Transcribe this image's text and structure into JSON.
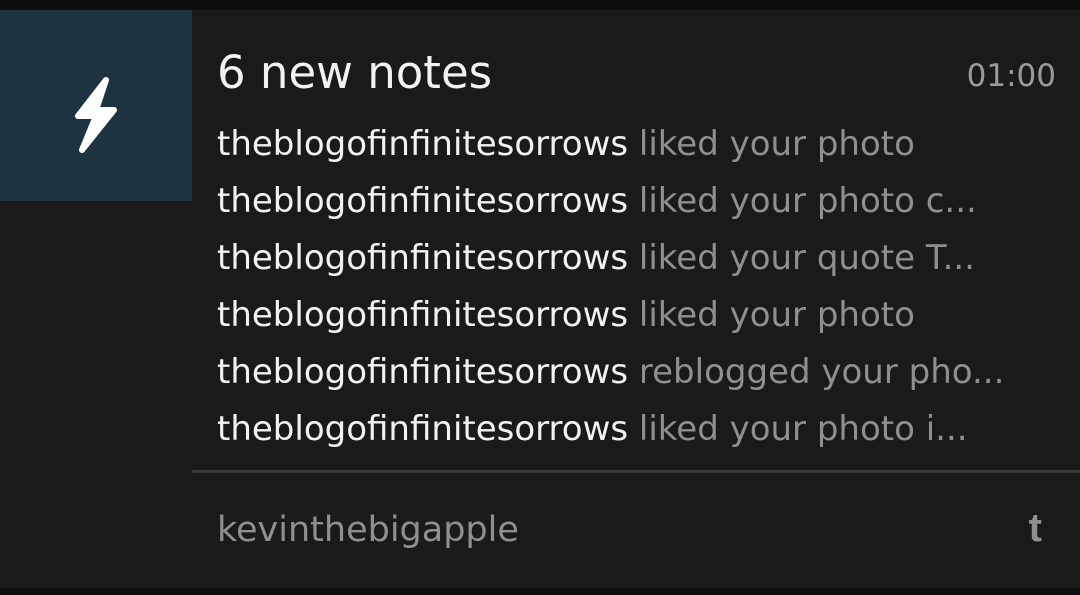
{
  "notification": {
    "title": "6 new notes",
    "time": "01:00",
    "icon": "lightning-bolt-icon",
    "accent_color": "#1d3440",
    "lines": [
      {
        "user": "theblogofinfinitesorrows",
        "action": "liked your photo"
      },
      {
        "user": "theblogofinfinitesorrows",
        "action": "liked your photo c..."
      },
      {
        "user": "theblogofinfinitesorrows",
        "action": "liked your quote T..."
      },
      {
        "user": "theblogofinfinitesorrows",
        "action": "liked your photo"
      },
      {
        "user": "theblogofinfinitesorrows",
        "action": "reblogged your pho..."
      },
      {
        "user": "theblogofinfinitesorrows",
        "action": "liked your photo i..."
      }
    ],
    "account": "kevinthebigapple",
    "app_icon": "tumblr-icon",
    "app_icon_glyph": "t"
  }
}
